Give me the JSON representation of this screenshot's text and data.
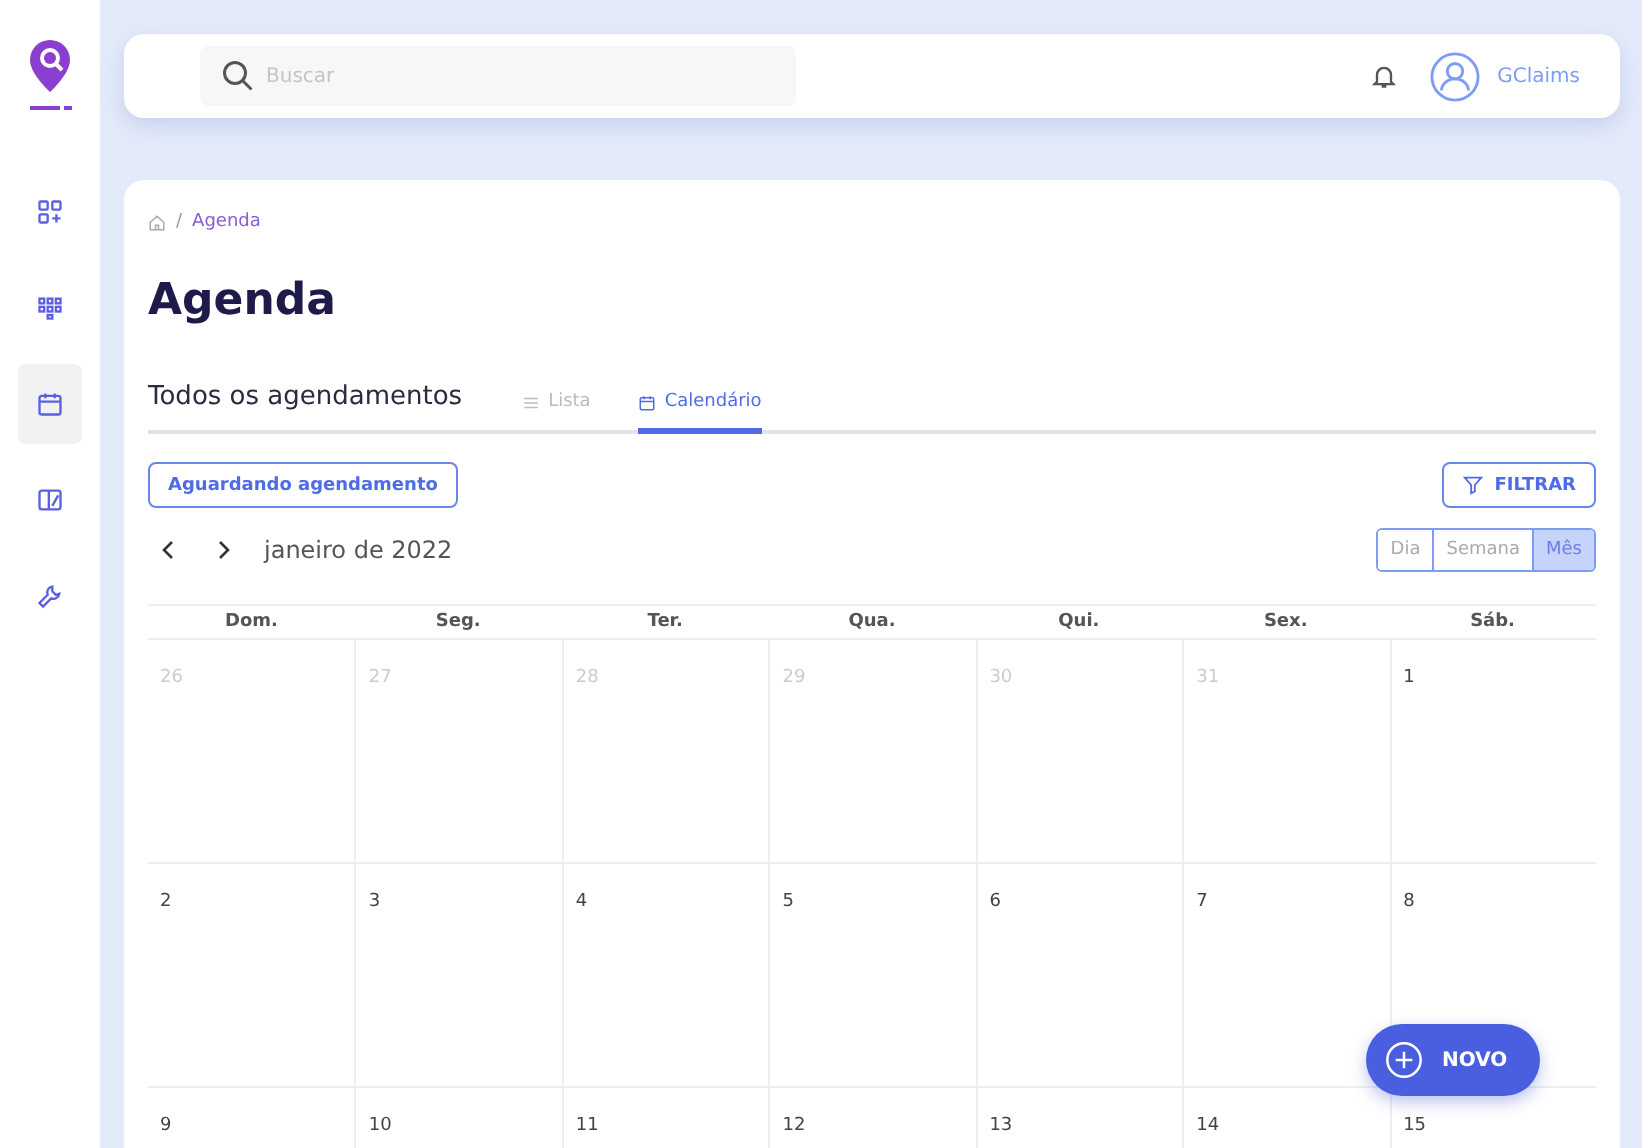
{
  "sidebar": {
    "items": [
      {
        "kind": "grid-plus",
        "selected": false
      },
      {
        "kind": "dots",
        "selected": false
      },
      {
        "kind": "calendar",
        "selected": true
      },
      {
        "kind": "book",
        "selected": false
      },
      {
        "kind": "wrench",
        "selected": false
      }
    ]
  },
  "header": {
    "search": {
      "placeholder": "Buscar"
    },
    "user": "GClaims"
  },
  "breadcrumb": {
    "separator": "/",
    "current": "Agenda"
  },
  "title": "Agenda",
  "tabs": [
    {
      "label": "Todos os agendamentos",
      "kind": "heading",
      "selected": false
    },
    {
      "label": "Lista",
      "kind": "list",
      "selected": false
    },
    {
      "label": "Calendário",
      "kind": "calendar",
      "selected": true
    }
  ],
  "waiting_button": "Aguardando agendamento",
  "filter_button": "FILTRAR",
  "month": "janeiro de 2022",
  "views": [
    {
      "label": "Dia",
      "selected": false
    },
    {
      "label": "Semana",
      "selected": false
    },
    {
      "label": "Mês",
      "selected": true
    }
  ],
  "weekdays": [
    "Dom.",
    "Seg.",
    "Ter.",
    "Qua.",
    "Qui.",
    "Sex.",
    "Sáb."
  ],
  "weeks": [
    [
      {
        "day": "26",
        "outside": true
      },
      {
        "day": "27",
        "outside": true
      },
      {
        "day": "28",
        "outside": true
      },
      {
        "day": "29",
        "outside": true
      },
      {
        "day": "30",
        "outside": true
      },
      {
        "day": "31",
        "outside": true
      },
      {
        "day": "1",
        "outside": false
      }
    ],
    [
      {
        "day": "2",
        "outside": false
      },
      {
        "day": "3",
        "outside": false
      },
      {
        "day": "4",
        "outside": false
      },
      {
        "day": "5",
        "outside": false
      },
      {
        "day": "6",
        "outside": false
      },
      {
        "day": "7",
        "outside": false
      },
      {
        "day": "8",
        "outside": false
      }
    ],
    [
      {
        "day": "9",
        "outside": false
      },
      {
        "day": "10",
        "outside": false
      },
      {
        "day": "11",
        "outside": false
      },
      {
        "day": "12",
        "outside": false
      },
      {
        "day": "13",
        "outside": false
      },
      {
        "day": "14",
        "outside": false
      },
      {
        "day": "15",
        "outside": false
      }
    ]
  ],
  "new_button": "NOVO"
}
